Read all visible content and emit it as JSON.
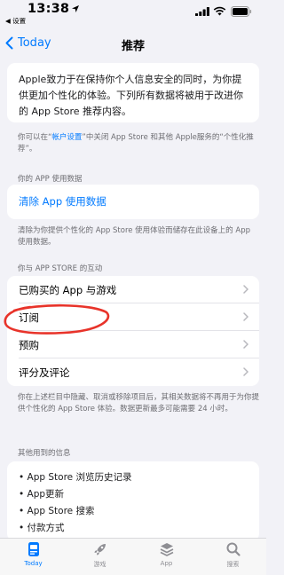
{
  "status_bar": {
    "time": "13:38",
    "back_app": "◀ 设置"
  },
  "nav": {
    "back_label": "Today",
    "title": "推荐"
  },
  "intro": {
    "text": "Apple致力于在保持你个人信息安全的同时，为你提供更加个性化的体验。下列所有数据将被用于改进你的 App Store 推荐内容。"
  },
  "account_note": {
    "prefix": "你可以在“",
    "link": "帐户设置",
    "suffix": "”中关闭 App Store 和其他 Apple服务的“个性化推荐”。"
  },
  "usage_section": {
    "header": "你的 APP 使用数据",
    "clear_button": "清除 App 使用数据",
    "note": "清除为你提供个性化的 App Store 使用体验而储存在此设备上的 App 使用数据。"
  },
  "interaction_section": {
    "header": "你与 APP STORE 的互动",
    "rows": [
      {
        "label": "已购买的 App 与游戏"
      },
      {
        "label": "订阅"
      },
      {
        "label": "预购"
      },
      {
        "label": "评分及评论"
      }
    ],
    "note": "你在上述栏目中隐藏、取消或移除项目后，其相关数据将不再用于为你提供个性化的 App Store 体验。数据更新最多可能需要 24 小时。"
  },
  "other_info": {
    "header": "其他用到的信息",
    "items": [
      "• App Store 浏览历史记录",
      "• App更新",
      "• App Store 搜索",
      "• 付款方式"
    ]
  },
  "tab_bar": {
    "tabs": [
      {
        "label": "Today",
        "icon": "today-icon",
        "active": true
      },
      {
        "label": "游戏",
        "icon": "rocket-icon",
        "active": false
      },
      {
        "label": "App",
        "icon": "layers-icon",
        "active": false
      },
      {
        "label": "搜索",
        "icon": "search-icon",
        "active": false
      }
    ]
  },
  "colors": {
    "accent": "#007aff",
    "annotation": "#e8332a",
    "background": "#f2f2f7"
  }
}
